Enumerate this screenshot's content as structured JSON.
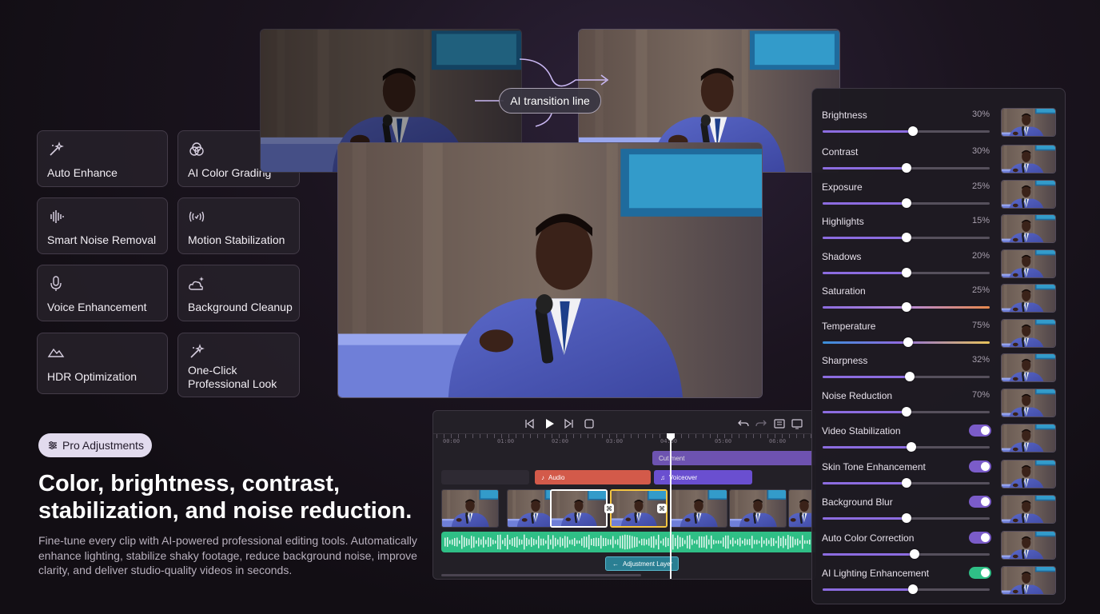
{
  "features": [
    {
      "label": "Auto Enhance",
      "icon": "magic-wand-icon"
    },
    {
      "label": "AI Color Grading",
      "icon": "color-circles-icon"
    },
    {
      "label": "Smart Noise Removal",
      "icon": "waveform-icon"
    },
    {
      "label": "Motion Stabilization",
      "icon": "stabilization-icon"
    },
    {
      "label": "Voice Enhancement",
      "icon": "microphone-icon"
    },
    {
      "label": "Background Cleanup",
      "icon": "cloud-sparkle-icon"
    },
    {
      "label": "HDR Optimization",
      "icon": "mountains-icon"
    },
    {
      "label": "One-Click\nProfessional Look",
      "icon": "magic-wand-icon"
    }
  ],
  "transition_label": "AI transition line",
  "pro_chip": "Pro Adjustments",
  "headline": "Color, brightness, contrast, stabilization, and noise reduction.",
  "description": "Fine-tune every clip with AI-powered professional editing tools. Automatically enhance lighting, stabilize shaky footage, reduce background noise, improve clarity, and deliver studio-quality videos in seconds.",
  "timeline": {
    "ruler": [
      "00:00",
      "01:00",
      "02:00",
      "03:00",
      "04:00",
      "05:00",
      "06:00"
    ],
    "tracks": {
      "cut": "Cut ment",
      "audio": "Audio",
      "voiceover": "Voiceover",
      "adjustment": "Adjustment Layer"
    },
    "colors": {
      "audio": "#d35a4a",
      "cut": "#7b5cc9",
      "voice": "#6a4fd0",
      "wave": "#2fbf86",
      "adjustment": "#2a7f93",
      "highlight": "#f4c542"
    }
  },
  "adjustments": [
    {
      "label": "Brightness",
      "value": "30%",
      "level": 0.54,
      "type": "slider"
    },
    {
      "label": "Contrast",
      "value": "30%",
      "level": 0.5,
      "type": "slider"
    },
    {
      "label": "Exposure",
      "value": "25%",
      "level": 0.5,
      "type": "slider"
    },
    {
      "label": "Highlights",
      "value": "15%",
      "level": 0.5,
      "type": "slider"
    },
    {
      "label": "Shadows",
      "value": "20%",
      "level": 0.5,
      "type": "slider"
    },
    {
      "label": "Saturation",
      "value": "25%",
      "level": 0.5,
      "type": "slider-saturation"
    },
    {
      "label": "Temperature",
      "value": "75%",
      "level": 0.51,
      "type": "slider-temperature"
    },
    {
      "label": "Sharpness",
      "value": "32%",
      "level": 0.52,
      "type": "slider"
    },
    {
      "label": "Noise Reduction",
      "value": "70%",
      "level": 0.5,
      "type": "slider"
    },
    {
      "label": "Video Stabilization",
      "value": "",
      "level": 0.53,
      "type": "toggle",
      "on_color": "#7b5cc9"
    },
    {
      "label": "Skin Tone Enhancement",
      "value": "",
      "level": 0.5,
      "type": "toggle",
      "on_color": "#7b5cc9"
    },
    {
      "label": "Background Blur",
      "value": "",
      "level": 0.5,
      "type": "toggle",
      "on_color": "#7b5cc9"
    },
    {
      "label": "Auto Color Correction",
      "value": "",
      "level": 0.55,
      "type": "toggle",
      "on_color": "#7b5cc9"
    },
    {
      "label": "AI Lighting Enhancement",
      "value": "",
      "level": 0.54,
      "type": "toggle",
      "on_color": "#2fbf86"
    }
  ]
}
